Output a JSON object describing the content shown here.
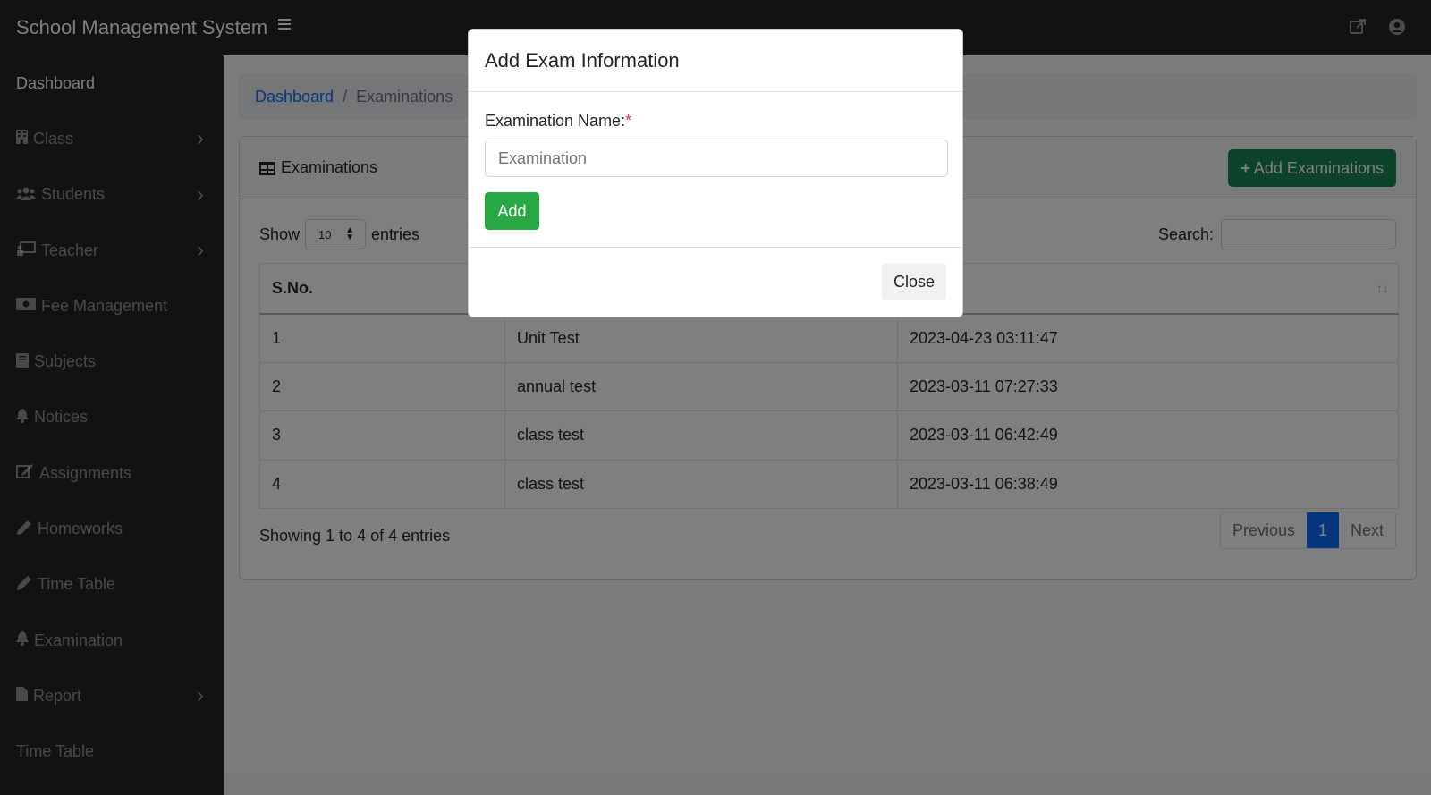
{
  "app": {
    "title": "School Management System"
  },
  "sidebar": {
    "items": [
      {
        "label": "Dashboard",
        "icon": "",
        "chevron": false
      },
      {
        "label": "Class",
        "icon": "building-icon",
        "chevron": true
      },
      {
        "label": "Students",
        "icon": "users-icon",
        "chevron": true
      },
      {
        "label": "Teacher",
        "icon": "chalkboard-teacher-icon",
        "chevron": true
      },
      {
        "label": "Fee Management",
        "icon": "money-bill-icon",
        "chevron": false
      },
      {
        "label": "Subjects",
        "icon": "book-icon",
        "chevron": false
      },
      {
        "label": "Notices",
        "icon": "bell-icon",
        "chevron": false
      },
      {
        "label": "Assignments",
        "icon": "edit-icon",
        "chevron": false
      },
      {
        "label": "Homeworks",
        "icon": "pencil-icon",
        "chevron": false
      },
      {
        "label": "Time Table",
        "icon": "pencil-icon",
        "chevron": false
      },
      {
        "label": "Examination",
        "icon": "bell-icon",
        "chevron": false
      },
      {
        "label": "Report",
        "icon": "file-icon",
        "chevron": true
      },
      {
        "label": "Time Table",
        "icon": "",
        "chevron": false
      }
    ]
  },
  "breadcrumb": {
    "home": "Dashboard",
    "separator": "/",
    "current": "Examinations"
  },
  "card": {
    "title": "Examinations",
    "add_button": "Add Examinations",
    "show_label": "Show",
    "entries_label": "entries",
    "page_length": "10",
    "search_label": "Search:"
  },
  "table": {
    "headers": [
      "S.No.",
      "",
      ""
    ],
    "rows": [
      [
        "1",
        "Unit Test",
        "2023-04-23 03:11:47"
      ],
      [
        "2",
        "annual test",
        "2023-03-11 07:27:33"
      ],
      [
        "3",
        "class test",
        "2023-03-11 06:42:49"
      ],
      [
        "4",
        "class test",
        "2023-03-11 06:38:49"
      ]
    ],
    "info": "Showing 1 to 4 of 4 entries"
  },
  "pagination": {
    "previous": "Previous",
    "current": "1",
    "next": "Next"
  },
  "modal": {
    "title": "Add Exam Information",
    "field_label": "Examination Name:",
    "required_mark": "*",
    "input_placeholder": "Examination",
    "input_value": "",
    "add_button": "Add",
    "close_button": "Close"
  },
  "colors": {
    "topbar": "#212529",
    "primary": "#0d6efd",
    "success": "#198754",
    "add_green": "#28a745",
    "required": "#dc3545"
  }
}
